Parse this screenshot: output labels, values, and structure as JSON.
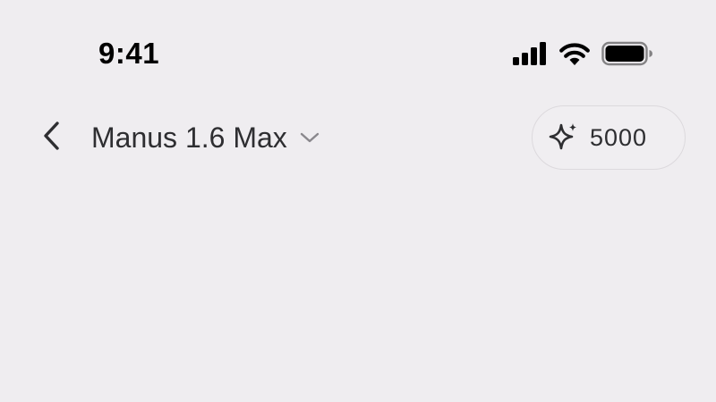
{
  "status_bar": {
    "time": "9:41",
    "icons": [
      "cellular-signal-icon",
      "wifi-icon",
      "battery-icon"
    ]
  },
  "header": {
    "back_icon": "chevron-left-icon",
    "model_title": "Manus 1.6 Max",
    "model_dropdown_icon": "chevron-down-icon",
    "credits": {
      "icon": "sparkle-icon",
      "value": "5000"
    }
  },
  "colors": {
    "background": "#efedf0",
    "text": "#2e2e31",
    "pill_border": "#dcd9dd"
  }
}
